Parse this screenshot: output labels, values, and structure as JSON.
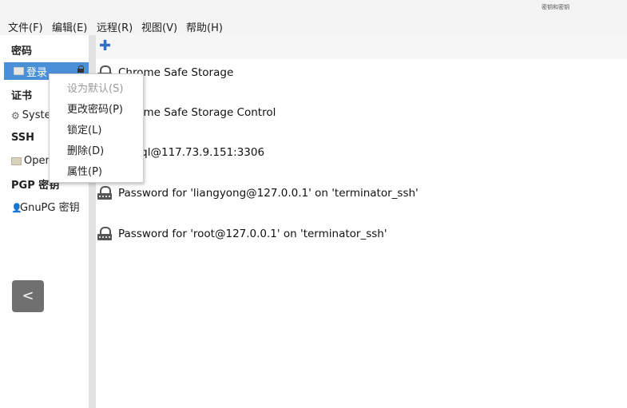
{
  "titlebar": {
    "text": "密钥和密钥"
  },
  "menu": [
    "文件(F)",
    "编辑(E)",
    "远程(R)",
    "视图(V)",
    "帮助(H)"
  ],
  "sidebar": {
    "sections": [
      {
        "title": "密码",
        "items": [
          {
            "label": "登录",
            "icon": "folder-icon",
            "selected": true,
            "locked": true
          }
        ]
      },
      {
        "title": "证书",
        "items": [
          {
            "label": "System",
            "icon": "gear-icon"
          }
        ]
      },
      {
        "title": "SSH",
        "items": [
          {
            "label": "OpenSSH",
            "icon": "folder-icon"
          }
        ]
      },
      {
        "title": "PGP 密钥",
        "items": [
          {
            "label": "GnuPG 密钥",
            "icon": "person-icon"
          }
        ]
      }
    ],
    "back_button": "<"
  },
  "toolbar": {
    "add_icon": "plus-icon"
  },
  "items": [
    "Chrome Safe Storage",
    "Chrome Safe Storage Control",
    "mysql@117.73.9.151:3306",
    "Password for 'liangyong@127.0.0.1' on 'terminator_ssh'",
    "Password for 'root@127.0.0.1' on 'terminator_ssh'"
  ],
  "context_menu": [
    {
      "label": "设为默认(S)",
      "disabled": true
    },
    {
      "label": "更改密码(P)",
      "disabled": false
    },
    {
      "label": "锁定(L)",
      "disabled": false
    },
    {
      "label": "删除(D)",
      "disabled": false
    },
    {
      "label": "属性(P)",
      "disabled": false
    }
  ],
  "colors": {
    "selection": "#4a90d9",
    "accent": "#2f6fc6",
    "back_button": "#707070"
  }
}
